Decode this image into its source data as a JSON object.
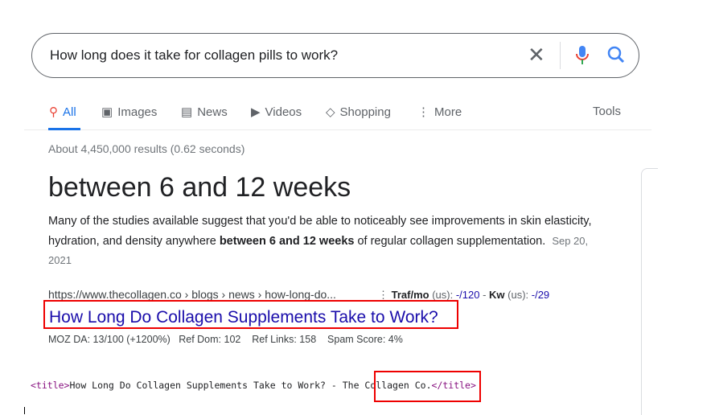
{
  "search": {
    "query": "How long does it take for collagen pills to work?"
  },
  "tabs": [
    {
      "label": "All",
      "icon": "search-icon",
      "active": true
    },
    {
      "label": "Images",
      "icon": "image-icon"
    },
    {
      "label": "News",
      "icon": "news-icon"
    },
    {
      "label": "Videos",
      "icon": "play-icon"
    },
    {
      "label": "Shopping",
      "icon": "tag-icon"
    },
    {
      "label": "More",
      "icon": "more-vert-icon"
    }
  ],
  "tools_label": "Tools",
  "stats": "About 4,450,000 results (0.62 seconds)",
  "featured": {
    "answer": "between 6 and 12 weeks",
    "snippet_pre": "Many of the studies available suggest that you'd be able to noticeably see improvements in skin elasticity, hydration, and density anywhere ",
    "snippet_bold": "between 6 and 12 weeks",
    "snippet_post": " of regular collagen supplementation.",
    "date": "Sep 20, 2021",
    "url": "https://www.thecollagen.co › blogs › news › how-long-do...",
    "title": "How Long Do Collagen Supplements Take to Work?"
  },
  "seo": {
    "traf_label": "Traf/mo",
    "traf_region": " (us): ",
    "traf_value": "-/120",
    "sep": " - ",
    "kw_label": "Kw",
    "kw_region": " (us): ",
    "kw_value": "-/29",
    "moz": "MOZ DA: 13/100 (+1200%)   Ref Dom: 102    Ref Links: 158    Spam Score: 4%"
  },
  "code": {
    "open": "<title>",
    "text": "How Long Do Collagen Supplements Take to Work? - The Collagen Co.",
    "close": "</title>"
  },
  "colors": {
    "link": "#1a0dab",
    "highlight": "#ee0000",
    "accent": "#1a73e8"
  }
}
